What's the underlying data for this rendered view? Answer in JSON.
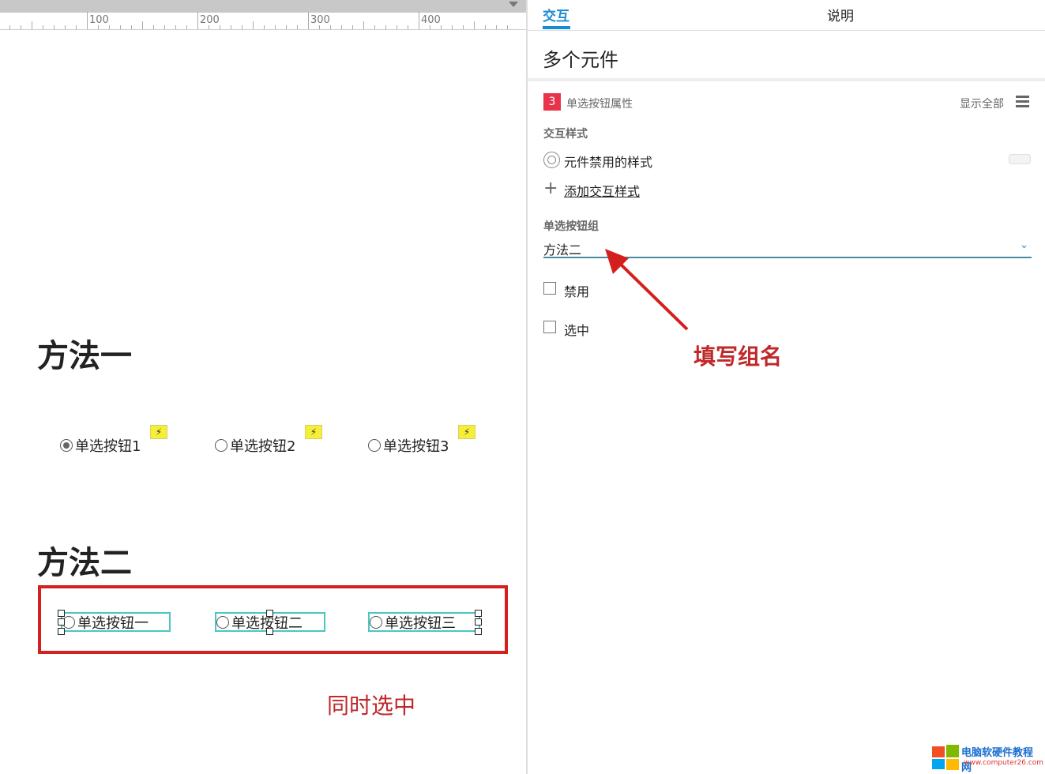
{
  "ruler": {
    "labels": [
      "100",
      "200",
      "300",
      "400"
    ]
  },
  "canvas": {
    "method1": {
      "title": "方法一",
      "radios": [
        {
          "label": "单选按钮1",
          "checked": true
        },
        {
          "label": "单选按钮2",
          "checked": false
        },
        {
          "label": "单选按钮3",
          "checked": false
        }
      ],
      "bolt_icon": "⚡"
    },
    "method2": {
      "title": "方法二",
      "radios": [
        {
          "label": "单选按钮一",
          "checked": false
        },
        {
          "label": "单选按钮二",
          "checked": false
        },
        {
          "label": "单选按钮三",
          "checked": false
        }
      ]
    },
    "annotation_select": "同时选中"
  },
  "panel": {
    "tabs": [
      {
        "label": "交互",
        "active": true
      },
      {
        "label": "说明",
        "active": false
      }
    ],
    "title": "多个元件",
    "count_badge": "3",
    "section_title": "单选按钮属性",
    "show_all": "显示全部",
    "interaction_style_label": "交互样式",
    "disabled_style": "元件禁用的样式",
    "add_style": "添加交互样式",
    "group_label": "单选按钮组",
    "group_value": "方法二",
    "checkbox_disabled": {
      "label": "禁用",
      "checked": false
    },
    "checkbox_selected": {
      "label": "选中",
      "checked": false
    },
    "annotation_group": "填写组名"
  },
  "watermark": {
    "text": "电脑软硬件教程网",
    "url": "www.computer26.com"
  },
  "colors": {
    "accent": "#1a8ad6",
    "badge": "#e8334a",
    "annotation": "#c0282a",
    "selection": "#4cc6c0"
  }
}
